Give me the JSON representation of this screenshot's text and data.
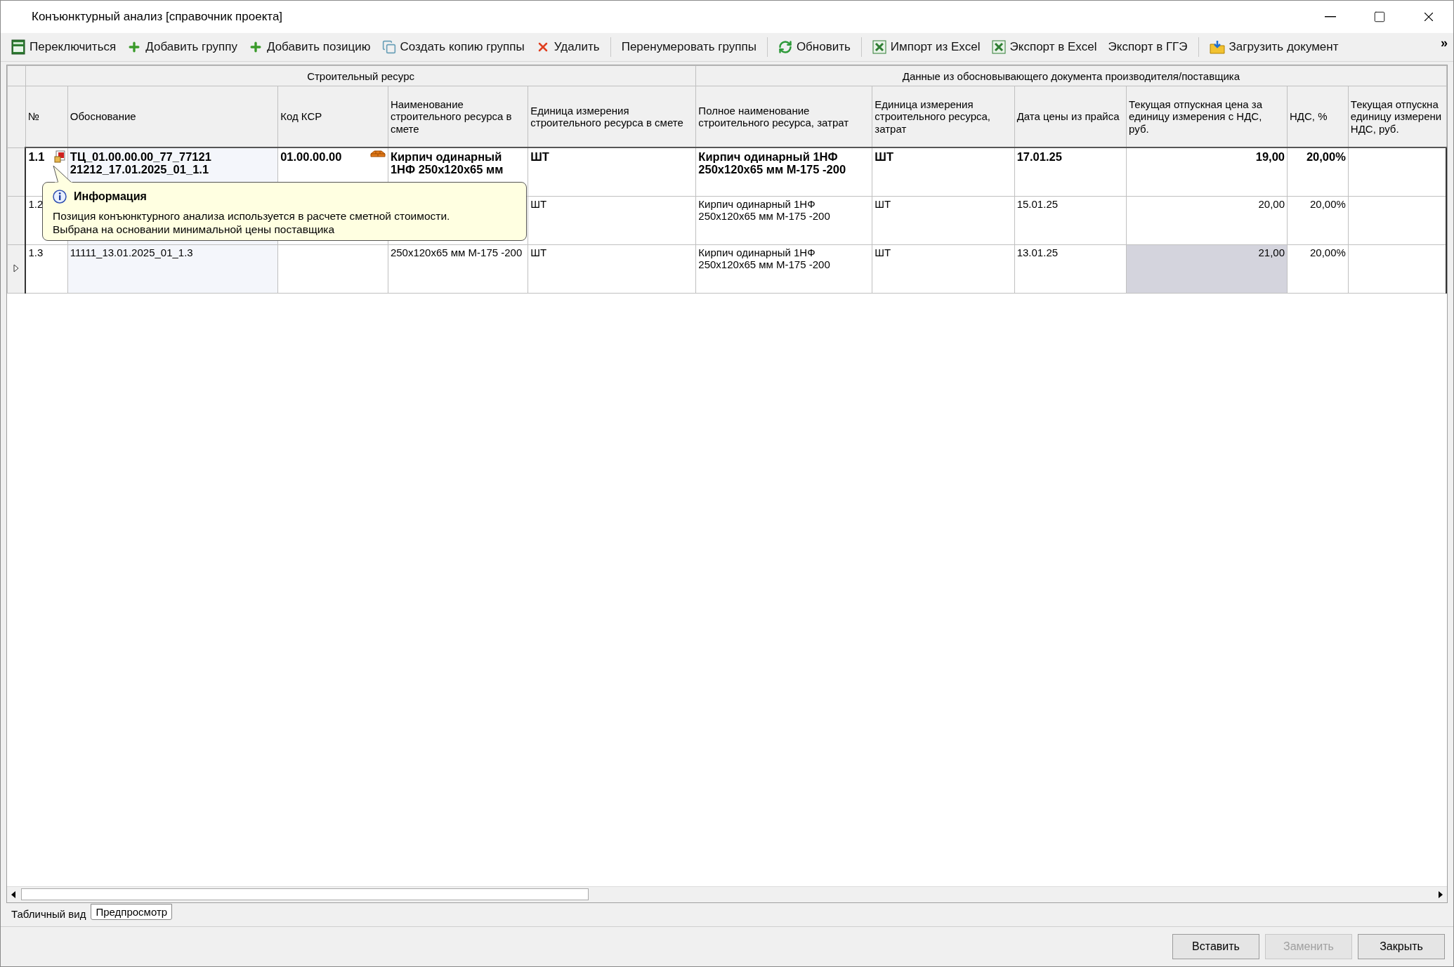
{
  "window": {
    "title": "Конъюнктурный анализ [справочник проекта]"
  },
  "toolbar": {
    "items": [
      {
        "label": "Переключиться",
        "kind": "sheet",
        "separator_before": false
      },
      {
        "label": "Добавить группу",
        "kind": "plus",
        "separator_before": false
      },
      {
        "label": "Добавить позицию",
        "kind": "plus",
        "separator_before": false
      },
      {
        "label": "Создать копию группы",
        "kind": "copy",
        "separator_before": false
      },
      {
        "label": "Удалить",
        "kind": "delete",
        "separator_before": false
      },
      {
        "label": "Перенумеровать группы",
        "kind": "plain",
        "separator_before": true
      },
      {
        "label": "Обновить",
        "kind": "refresh",
        "separator_before": true
      },
      {
        "label": "Импорт из Excel",
        "kind": "excel",
        "separator_before": true
      },
      {
        "label": "Экспорт в Excel",
        "kind": "excel",
        "separator_before": false
      },
      {
        "label": "Экспорт в ГГЭ",
        "kind": "plain",
        "separator_before": false
      },
      {
        "label": "Загрузить документ",
        "kind": "folder",
        "separator_before": true
      }
    ],
    "overflow": "»"
  },
  "table": {
    "groups": [
      {
        "label": "Строительный ресурс",
        "columns": [
          "№",
          "Обоснование",
          "Код КСР",
          "Наименование строительного ресурса в смете",
          "Единица измерения строительного ресурса в смете"
        ]
      },
      {
        "label": "Данные из обосновывающего документа производителя/поставщика",
        "columns": [
          "Полное наименование строительного ресурса, затрат",
          "Единица измерения строительного ресурса, затрат",
          "Дата цены из прайса",
          "Текущая отпускная цена за единицу измерения с НДС, руб.",
          "НДС, %",
          "Текущая отпускна\nединицу измерени\nНДС, руб."
        ]
      }
    ],
    "rows": [
      {
        "number": "1.1",
        "basis": "ТЦ_01.00.00.00_77_77121 21212_17.01.2025_01_1.1",
        "code": "01.00.00.00",
        "name": "Кирпич одинарный 1НФ 250x120x65 мм",
        "unit": "ШТ",
        "full_name": "Кирпич одинарный 1НФ 250x120x65 мм М-175 -200",
        "full_unit": "ШТ",
        "price_date": "17.01.25",
        "price": "19,00",
        "vat": "20,00%",
        "used": true,
        "current": false,
        "price_selected": false
      },
      {
        "number": "1.2",
        "unit": "ШТ",
        "full_name": "Кирпич одинарный 1НФ 250x120x65 мм М-175 -200",
        "full_unit": "ШТ",
        "price_date": "15.01.25",
        "price": "20,00",
        "vat": "20,00%",
        "used": false,
        "current": false,
        "price_selected": false
      },
      {
        "number": "1.3",
        "basis": "11111_13.01.2025_01_1.3",
        "name": "250x120x65 мм М-175 -200",
        "unit": "ШТ",
        "full_name": "Кирпич одинарный 1НФ 250x120x65 мм М-175 -200",
        "full_unit": "ШТ",
        "price_date": "13.01.25",
        "price": "21,00",
        "vat": "20,00%",
        "used": false,
        "current": true,
        "price_selected": true
      }
    ]
  },
  "tooltip": {
    "title": "Информация",
    "text": "Позиция конъюнктурного анализа используется в расчете сметной стоимости.\nВыбрана на основании минимальной цены поставщика"
  },
  "view_tabs": [
    {
      "label": "Табличный вид",
      "selected": true
    },
    {
      "label": "Предпросмотр",
      "selected": false
    }
  ],
  "buttons": [
    {
      "label": "Вставить",
      "disabled": false
    },
    {
      "label": "Заменить",
      "disabled": true
    },
    {
      "label": "Закрыть",
      "disabled": false
    }
  ]
}
